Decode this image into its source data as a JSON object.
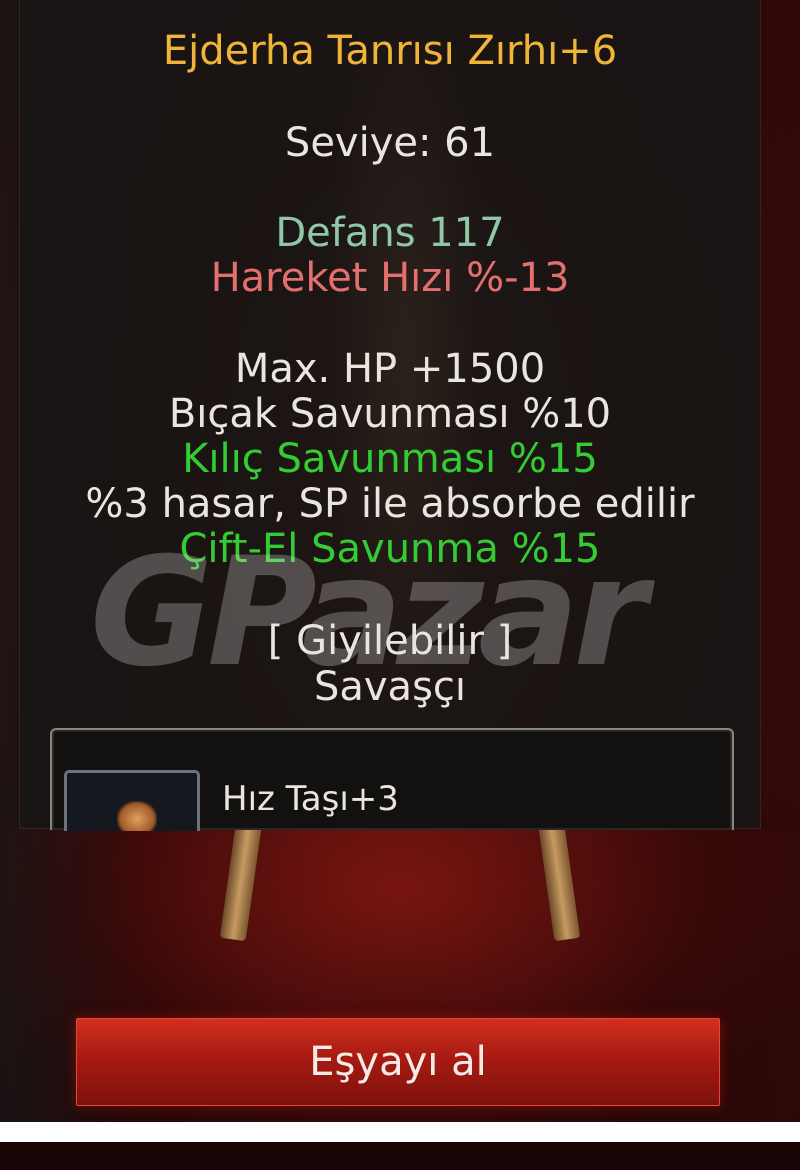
{
  "item": {
    "name": "Ejderha Tanrısı Zırhı+6",
    "level": "Seviye: 61",
    "defense": "Defans 117",
    "move_speed": "Hareket Hızı %-13",
    "bonuses": [
      "Max. HP +1500",
      "Bıçak Savunması %10",
      "Kılıç Savunması %15",
      "%3 hasar, SP ile absorbe edilir",
      "Çift-El Savunma %15"
    ],
    "wearable": "[ Giyilebilir ]",
    "class": "Savaşçı"
  },
  "socket": {
    "stone_name": "Hız Taşı+3",
    "icon": "speed-stone-icon"
  },
  "watermark": "GPazar",
  "actions": {
    "take_item_label": "Eşyayı al"
  },
  "colors": {
    "item_name": "#f0b43a",
    "base_stat": "#8fc8a6",
    "penalty_stat": "#e36f6f",
    "bonus_green": "#33cc33",
    "button_red": "#a81a12"
  }
}
